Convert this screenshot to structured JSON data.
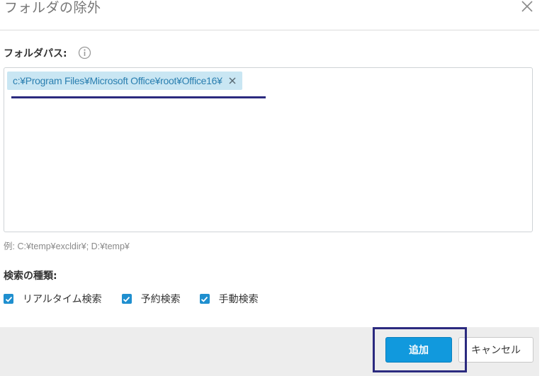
{
  "dialog": {
    "title": "フォルダの除外"
  },
  "folder_path": {
    "label": "フォルダパス:",
    "entries": [
      {
        "path": "c:¥Program Files¥Microsoft Office¥root¥Office16¥"
      }
    ],
    "hint": "例: C:¥temp¥excldir¥; D:¥temp¥"
  },
  "search_type": {
    "label": "検索の種類:",
    "options": [
      {
        "label": "リアルタイム検索",
        "checked": true
      },
      {
        "label": "予約検索",
        "checked": true
      },
      {
        "label": "手動検索",
        "checked": true
      }
    ]
  },
  "footer": {
    "add_label": "追加",
    "cancel_label": "キャンセル"
  },
  "colors": {
    "accent": "#1199dd",
    "chip_background": "#c9e6f3",
    "chip_text": "#2a7fb0",
    "annotation": "#2b2a7f"
  },
  "icons": {
    "close": "close-icon",
    "info": "info-icon",
    "remove": "remove-icon",
    "check": "check-icon"
  }
}
